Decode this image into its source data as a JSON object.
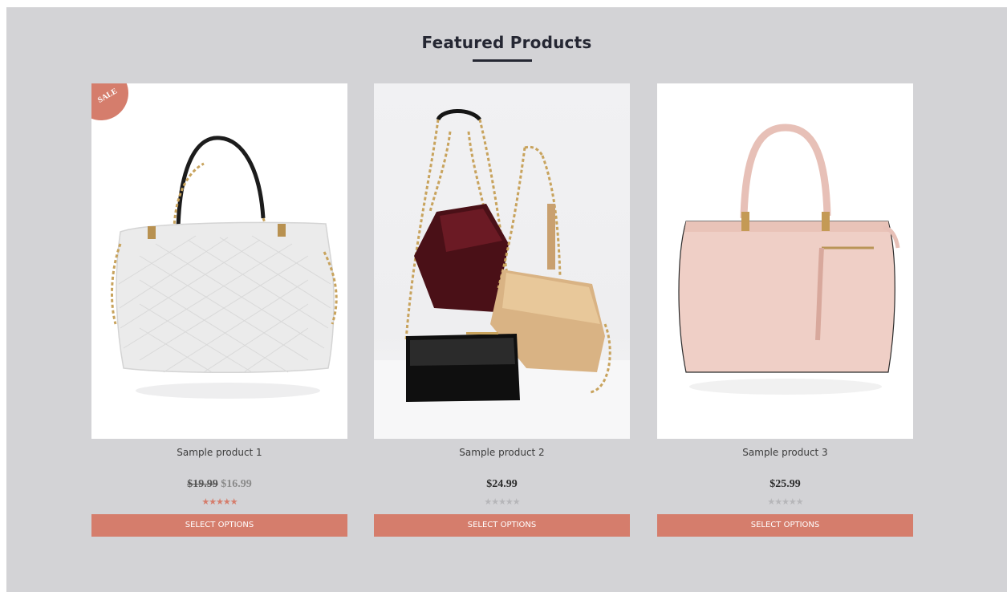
{
  "section": {
    "title": "Featured Products"
  },
  "products": [
    {
      "name": "Sample product 1",
      "badge": "SALE",
      "old_price": "$19.99",
      "price": "$16.99",
      "rating": 5,
      "rating_stars": "★★★★★",
      "button_label": "SELECT OPTIONS",
      "image": "white-quilted-handbag"
    },
    {
      "name": "Sample product 2",
      "price": "$24.99",
      "rating": 0,
      "rating_stars": "★★★★★",
      "button_label": "SELECT OPTIONS",
      "image": "patent-chain-bags"
    },
    {
      "name": "Sample product 3",
      "price": "$25.99",
      "rating": 0,
      "rating_stars": "★★★★★",
      "button_label": "SELECT OPTIONS",
      "image": "pink-tote-handbag"
    }
  ],
  "colors": {
    "background": "#d3d3d6",
    "accent": "#d57d6c",
    "heading": "#252733"
  }
}
